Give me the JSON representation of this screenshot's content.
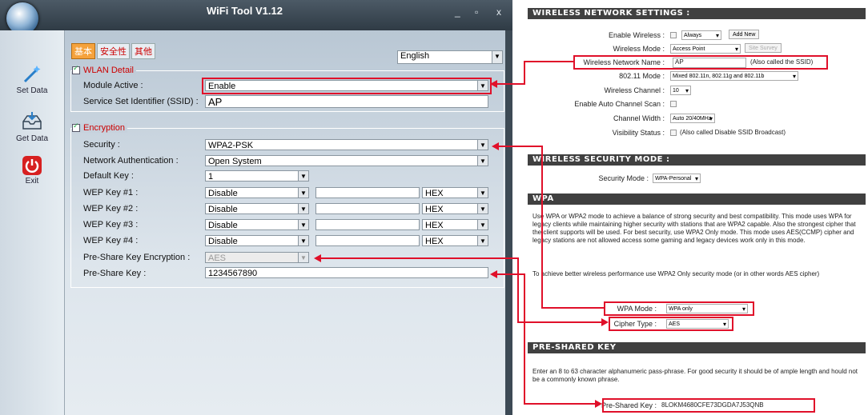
{
  "window": {
    "title": "WiFi Tool V1.12",
    "min": "_",
    "max": "▫",
    "close": "x"
  },
  "sidebar": [
    {
      "label": "Set Data"
    },
    {
      "label": "Get Data"
    },
    {
      "label": "Exit"
    }
  ],
  "tabs": [
    "基本",
    "安全性",
    "其他"
  ],
  "language": "English",
  "wlan": {
    "title": "WLAN Detail",
    "module_label": "Module Active :",
    "module_value": "Enable",
    "ssid_label": "Service Set Identifier (SSID) :",
    "ssid_value": "AP"
  },
  "encryption": {
    "title": "Encryption",
    "security_label": "Security :",
    "security_value": "WPA2-PSK",
    "auth_label": "Network Authentication :",
    "auth_value": "Open System",
    "default_key_label": "Default Key :",
    "default_key_value": "1",
    "wep": [
      {
        "label": "WEP Key #1 :",
        "mode": "Disable",
        "fmt": "HEX"
      },
      {
        "label": "WEP Key #2 :",
        "mode": "Disable",
        "fmt": "HEX"
      },
      {
        "label": "WEP Key #3 :",
        "mode": "Disable",
        "fmt": "HEX"
      },
      {
        "label": "WEP Key #4 :",
        "mode": "Disable",
        "fmt": "HEX"
      }
    ],
    "psk_enc_label": "Pre-Share Key Encryption :",
    "psk_enc_value": "AES",
    "psk_label": "Pre-Share Key :",
    "psk_value": "1234567890"
  },
  "router": {
    "wns_header": "WIRELESS NETWORK SETTINGS :",
    "enable_wireless_label": "Enable Wireless :",
    "enable_wireless_sched": "Always",
    "add_new": "Add New",
    "wireless_mode_label": "Wireless Mode :",
    "wireless_mode_value": "Access Point",
    "site_survey": "Site Survey",
    "ssid_label": "Wireless Network Name :",
    "ssid_value": "AP",
    "ssid_note": "(Also called the SSID)",
    "mode80211_label": "802.11 Mode :",
    "mode80211_value": "Mixed 802.11n, 802.11g and 802.11b",
    "channel_label": "Wireless Channel :",
    "channel_value": "10",
    "auto_scan_label": "Enable Auto Channel Scan :",
    "width_label": "Channel Width :",
    "width_value": "Auto 20/40MHz",
    "visibility_label": "Visibility Status :",
    "visibility_note": "(Also called Disable SSID Broadcast)",
    "wsm_header": "WIRELESS SECURITY MODE :",
    "sec_mode_label": "Security Mode :",
    "sec_mode_value": "WPA-Personal",
    "wpa_header": "WPA",
    "wpa_para1": "Use WPA or WPA2 mode to achieve a balance of strong security and best compatibility. This mode uses WPA for legacy clients while maintaining higher security with stations that are WPA2 capable. Also the strongest cipher that the client supports will be used. For best security, use WPA2 Only mode. This mode uses AES(CCMP) cipher and legacy stations are not allowed access some gaming and legacy devices work only in this mode.",
    "wpa_para2": "To achieve better wireless performance use WPA2 Only security mode (or in other words AES cipher)",
    "wpa_mode_label": "WPA Mode :",
    "wpa_mode_value": "WPA only",
    "cipher_label": "Cipher Type :",
    "cipher_value": "AES",
    "psk_header": "PRE-SHARED KEY",
    "psk_para": "Enter an 8 to 63 character alphanumeric pass-phrase. For good security it should be of ample length and hould not be a commonly known phrase.",
    "psk_label": "Pre-Shared Key :",
    "psk_value": "8LOKM4680CFE73DGDA7J53QNB"
  },
  "colors": {
    "annotation_red": "#e0102a",
    "tab_active": "#f5a23c",
    "header_dark": "#404040"
  }
}
